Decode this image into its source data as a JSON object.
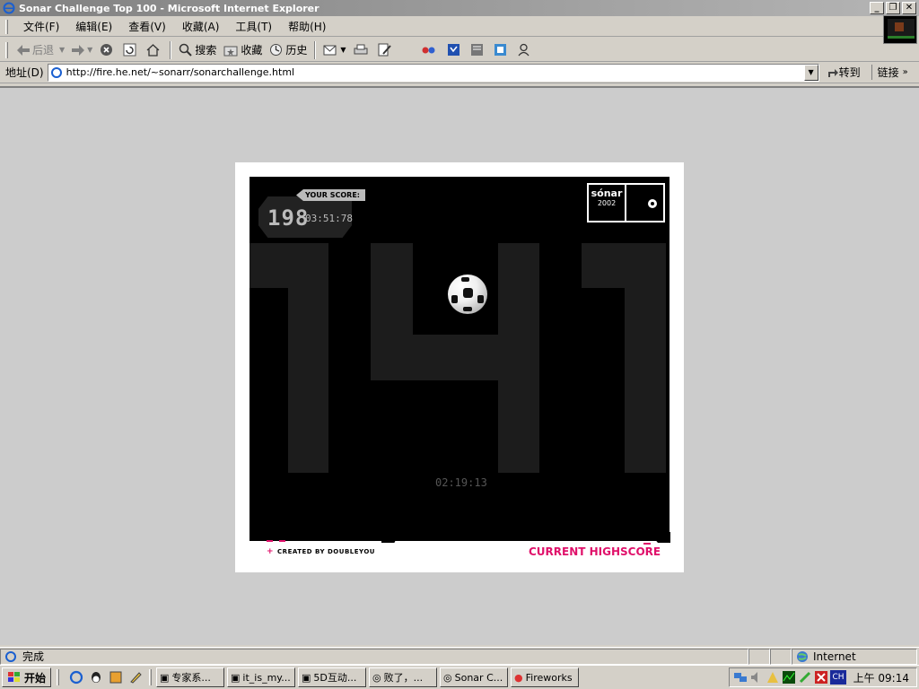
{
  "window": {
    "title": "Sonar Challenge Top 100 - Microsoft Internet Explorer"
  },
  "menu": [
    "文件(F)",
    "编辑(E)",
    "查看(V)",
    "收藏(A)",
    "工具(T)",
    "帮助(H)"
  ],
  "toolbar": {
    "back": "后退",
    "search": "搜索",
    "favorites": "收藏",
    "history": "历史"
  },
  "address": {
    "label": "地址(D)",
    "url": "http://fire.he.net/~sonarr/sonarchallenge.html",
    "go": "转到",
    "links": "链接"
  },
  "game": {
    "your_score_label": "YOUR SCORE:",
    "score": "198",
    "score_time": "03:51:78",
    "logo_name": "sónar",
    "logo_year": "2002",
    "timer": "02:19:13",
    "credit": "CREATED BY DOUBLEYOU",
    "highscore_label": "CURRENT HIGHSCORE",
    "bg_number": "141",
    "accent": "#e0106a"
  },
  "status": {
    "text": "完成",
    "zone": "Internet"
  },
  "taskbar": {
    "start": "开始",
    "tasks": [
      "专家系...",
      "it_is_my...",
      "5D互动...",
      "败了，...",
      "Sonar C...",
      "Fireworks"
    ],
    "lang": "CH",
    "clock": "上午 09:14"
  }
}
